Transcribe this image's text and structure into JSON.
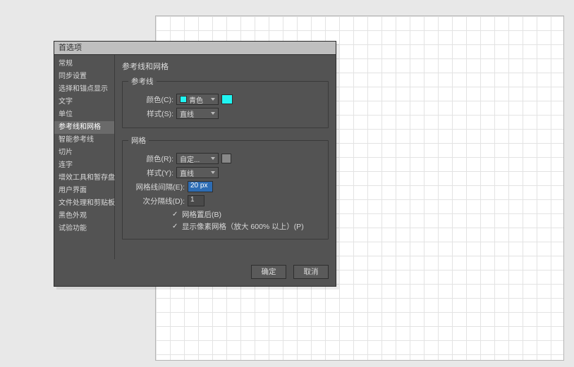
{
  "dialog": {
    "title": "首选项"
  },
  "sidebar": {
    "items": [
      "常规",
      "同步设置",
      "选择和锚点显示",
      "文字",
      "单位",
      "参考线和网格",
      "智能参考线",
      "切片",
      "连字",
      "增效工具和暂存盘",
      "用户界面",
      "文件处理和剪贴板",
      "黑色外观",
      "试验功能"
    ],
    "selected_index": 5
  },
  "panel": {
    "heading": "参考线和网格",
    "group_guides": {
      "legend": "参考线",
      "color_label": "颜色(C):",
      "color_value": "青色",
      "color_swatch": "#20f5f2",
      "style_label": "样式(S):",
      "style_value": "直线"
    },
    "group_grid": {
      "legend": "网格",
      "color_label": "颜色(R):",
      "color_value": "自定...",
      "color_swatch": "#888888",
      "style_label": "样式(Y):",
      "style_value": "直线",
      "spacing_label": "网格线间隔(E):",
      "spacing_value": "20 px",
      "subdiv_label": "次分隔线(D):",
      "subdiv_value": "1",
      "check_back_label": "网格置后(B)",
      "check_back_checked": true,
      "check_pixel_label": "显示像素网格（放大 600% 以上）(P)",
      "check_pixel_checked": true
    }
  },
  "buttons": {
    "ok": "确定",
    "cancel": "取消"
  }
}
